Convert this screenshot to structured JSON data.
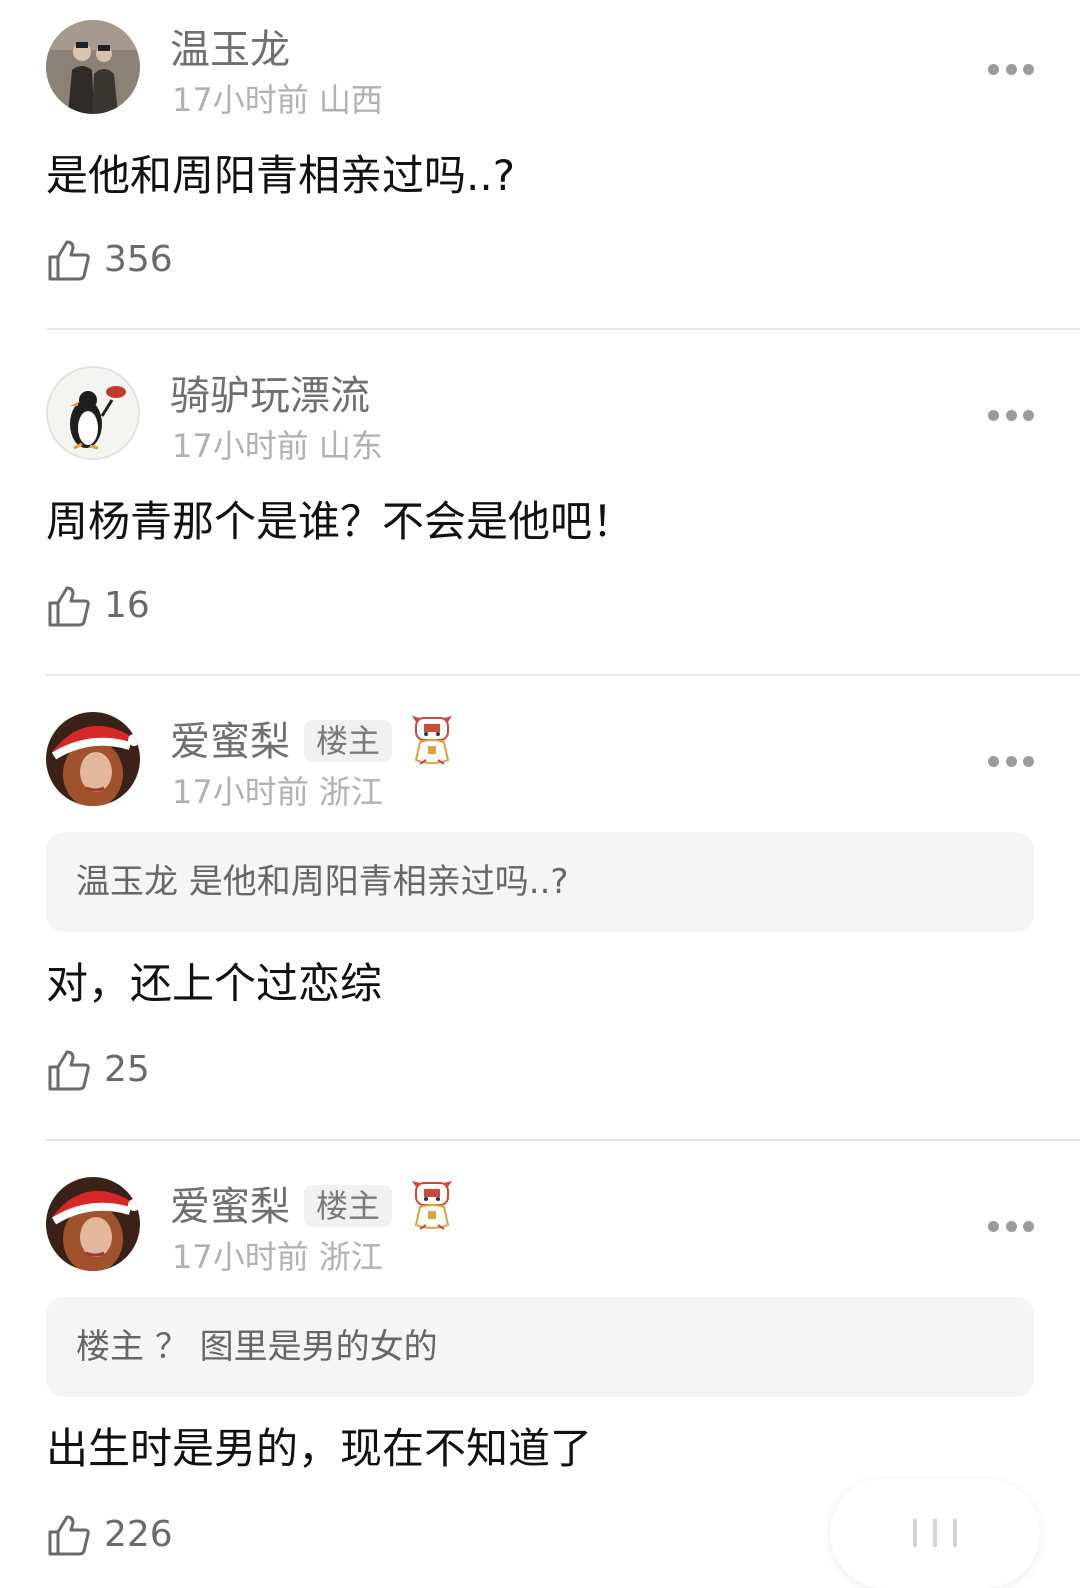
{
  "comments": [
    {
      "username": "温玉龙",
      "time": "17小时前",
      "location": "山西",
      "text": "是他和周阳青相亲过吗..?",
      "likes": "356"
    },
    {
      "username": "骑驴玩漂流",
      "time": "17小时前",
      "location": "山东",
      "text": "周杨青那个是谁？不会是他吧！",
      "likes": "16"
    },
    {
      "username": "爱蜜梨",
      "badge": "楼主",
      "time": "17小时前",
      "location": "浙江",
      "quote_user": "温玉龙",
      "quote_text": "是他和周阳青相亲过吗..?",
      "text": "对，还上个过恋综",
      "likes": "25"
    },
    {
      "username": "爱蜜梨",
      "badge": "楼主",
      "time": "17小时前",
      "location": "浙江",
      "quote_user": "楼主",
      "quote_text": "？ 图里是男的女的",
      "text": "出生时是男的，现在不知道了",
      "likes": "226"
    }
  ],
  "icons": {
    "like": "thumbs-up-icon",
    "more": "more-dots-icon",
    "mascot": "tiger-mascot-icon"
  },
  "colors": {
    "username": "#6f6f6f",
    "meta": "#b1b1b1",
    "quote_bg": "#f5f5f5",
    "divider": "#e8e8e8"
  }
}
